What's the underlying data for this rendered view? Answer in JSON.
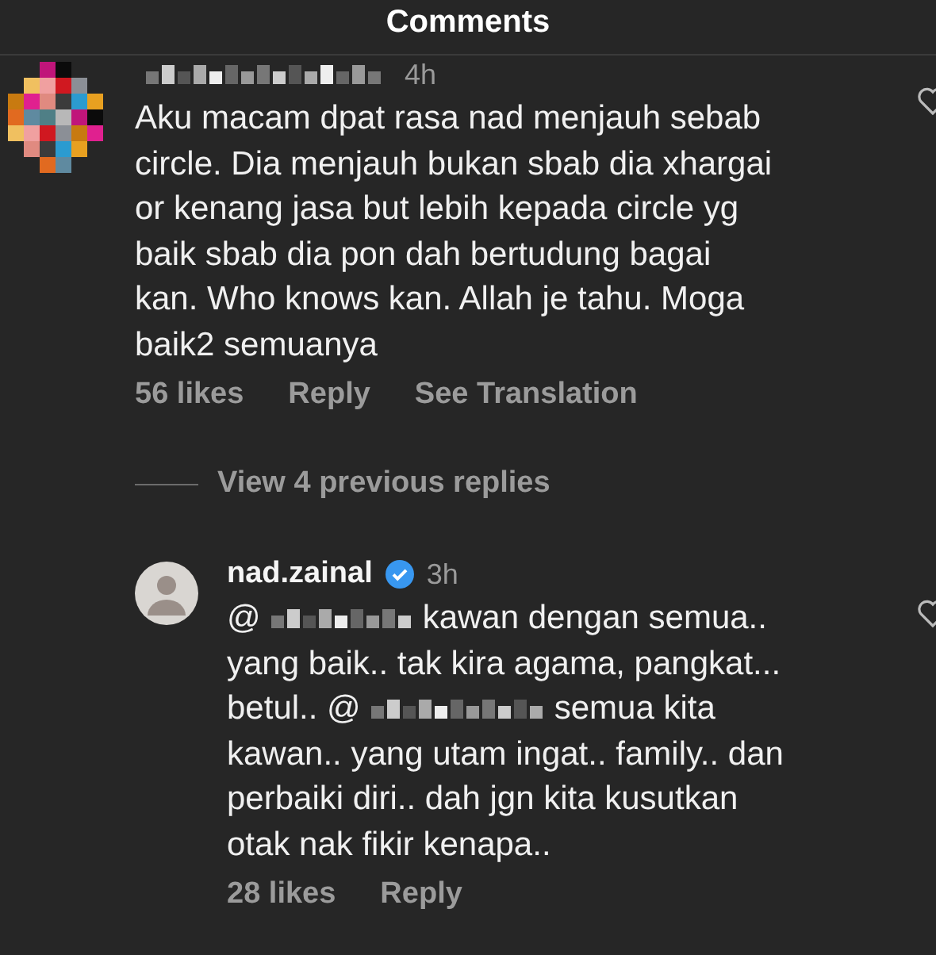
{
  "header": {
    "title": "Comments"
  },
  "comments": [
    {
      "kind": "comment",
      "username": [
        {
          "kind": "redacted"
        }
      ],
      "verified": false,
      "time": "4h",
      "lines": [
        [
          {
            "kind": "text",
            "text": "Aku macam dpat rasa nad menjauh sebab"
          }
        ],
        [
          {
            "kind": "text",
            "text": "circle. Dia menjauh bukan sbab dia xhargai"
          }
        ],
        [
          {
            "kind": "text",
            "text": "or kenang jasa but lebih kepada circle yg"
          }
        ],
        [
          {
            "kind": "text",
            "text": "baik sbab dia pon dah bertudung bagai"
          }
        ],
        [
          {
            "kind": "text",
            "text": "kan. Who knows kan. Allah je tahu. Moga"
          }
        ],
        [
          {
            "kind": "text",
            "text": "baik2 semuanya"
          }
        ]
      ],
      "likes": "56 likes",
      "reply": "Reply",
      "translate": "See Translation",
      "replies": {
        "label": "View 4 previous replies"
      }
    },
    {
      "kind": "reply",
      "username": [
        {
          "kind": "text",
          "text": "nad.zainal"
        }
      ],
      "verified": true,
      "time": "3h",
      "lines": [
        [
          {
            "kind": "text",
            "text": "@"
          },
          {
            "kind": "redacted"
          },
          {
            "kind": "text",
            "text": "kawan dengan semua.."
          }
        ],
        [
          {
            "kind": "text",
            "text": "yang baik.. tak kira agama, pangkat..."
          }
        ],
        [
          {
            "kind": "text",
            "text": "betul.. @"
          },
          {
            "kind": "redacted"
          },
          {
            "kind": "text",
            "text": "semua kita"
          }
        ],
        [
          {
            "kind": "text",
            "text": "kawan.. yang utam ingat.. family.. dan"
          }
        ],
        [
          {
            "kind": "text",
            "text": "perbaiki diri.. dah jgn kita kusutkan"
          }
        ],
        [
          {
            "kind": "text",
            "text": "otak nak fikir kenapa.."
          }
        ]
      ],
      "likes": "28 likes",
      "reply": "Reply"
    }
  ]
}
